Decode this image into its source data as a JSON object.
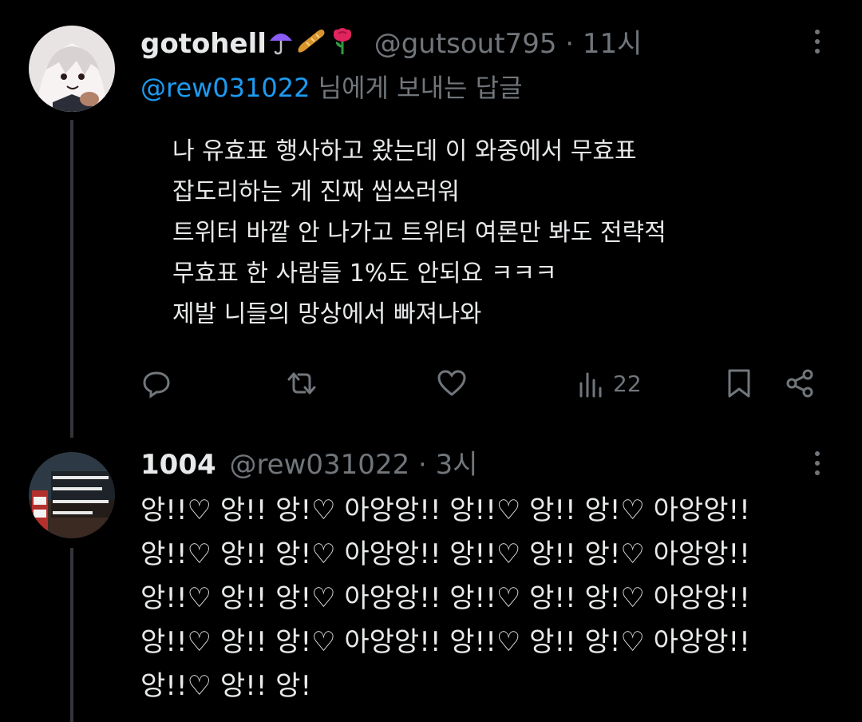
{
  "tweet1": {
    "display_name": "gotohell",
    "name_emojis": [
      "umbrella",
      "baguette",
      "rose"
    ],
    "handle": "@gutsout795",
    "separator": "·",
    "time": "11시",
    "reply_mention": "@rew031022",
    "reply_suffix": "님에게 보내는 답글",
    "body_lines": [
      "나 유효표 행사하고 왔는데 이 와중에서 무효표",
      "잡도리하는 게 진짜 씹쓰러워",
      "트위터 바깥 안 나가고 트위터 여론만 봐도 전략적",
      "무효표 한 사람들 1%도 안되요 ㅋㅋㅋ",
      "제발 니들의 망상에서 빠져나와"
    ],
    "actions": {
      "reply_icon": "reply-icon",
      "retweet_icon": "retweet-icon",
      "like_icon": "heart-icon",
      "views_icon": "views-icon",
      "views_count": "22",
      "bookmark_icon": "bookmark-icon",
      "share_icon": "share-icon"
    }
  },
  "tweet2": {
    "display_name": "1004",
    "handle": "@rew031022",
    "separator": "·",
    "time": "3시",
    "body_lines": [
      "앙!!♡ 앙!! 앙!♡ 아앙앙!! 앙!!♡ 앙!! 앙!♡ 아앙앙!!",
      "앙!!♡ 앙!! 앙!♡ 아앙앙!! 앙!!♡ 앙!! 앙!♡ 아앙앙!!",
      "앙!!♡ 앙!! 앙!♡ 아앙앙!! 앙!!♡ 앙!! 앙!♡ 아앙앙!!",
      "앙!!♡ 앙!! 앙!♡ 아앙앙!! 앙!!♡ 앙!! 앙!♡ 아앙앙!!",
      "앙!!♡ 앙!! 앙!"
    ]
  },
  "colors": {
    "background": "#000000",
    "text": "#e7e9ea",
    "secondary": "#71767b",
    "link": "#1d9bf0",
    "rose": "#e0245e"
  }
}
